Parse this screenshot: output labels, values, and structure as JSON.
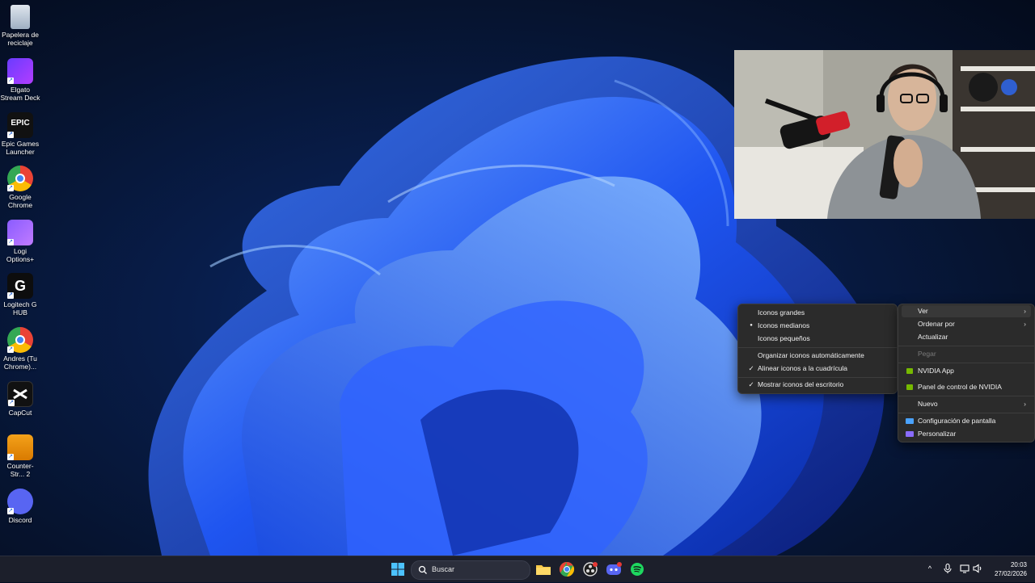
{
  "desktop_icons": [
    {
      "label": "Papelera de reciclaje",
      "icon": "recycle-bin-icon"
    },
    {
      "label": "Elgato Stream Deck",
      "icon": "stream-deck-icon"
    },
    {
      "label": "Epic Games Launcher",
      "icon": "epic-games-icon",
      "glyph": "EPIC"
    },
    {
      "label": "Google Chrome",
      "icon": "chrome-icon"
    },
    {
      "label": "Logi Options+",
      "icon": "logi-options-icon"
    },
    {
      "label": "Logitech G HUB",
      "icon": "logitech-g-hub-icon",
      "glyph": "G"
    },
    {
      "label": "Andres (Tu Chrome)...",
      "icon": "chrome-profile-icon"
    },
    {
      "label": "CapCut",
      "icon": "capcut-icon"
    },
    {
      "label": "Counter-Str... 2",
      "icon": "counter-strike-icon"
    },
    {
      "label": "Discord",
      "icon": "discord-icon"
    }
  ],
  "context_menu": {
    "items": [
      {
        "label": "Ver",
        "submenu": true
      },
      {
        "label": "Ordenar por",
        "submenu": true
      },
      {
        "label": "Actualizar"
      },
      {
        "label": "Pegar",
        "disabled": true
      },
      {
        "label": "NVIDIA App",
        "icon": "nvidia-icon"
      },
      {
        "label": "Panel de control de NVIDIA",
        "icon": "nvidia-icon"
      },
      {
        "label": "Nuevo",
        "submenu": true
      },
      {
        "label": "Configuración de pantalla",
        "icon": "display-icon"
      },
      {
        "label": "Personalizar",
        "icon": "personalize-icon"
      }
    ],
    "arrow": "›"
  },
  "view_submenu": {
    "items": [
      {
        "label": "Iconos grandes"
      },
      {
        "label": "Iconos medianos",
        "mark": "●"
      },
      {
        "label": "Iconos pequeños"
      },
      {
        "label": "Organizar iconos automáticamente"
      },
      {
        "label": "Alinear iconos a la cuadrícula",
        "mark": "✓"
      },
      {
        "label": "Mostrar iconos del escritorio",
        "mark": "✓"
      }
    ]
  },
  "taskbar": {
    "search_label": "Buscar",
    "apps": [
      "start-icon",
      "file-explorer-icon",
      "chrome-icon",
      "obs-icon",
      "discord-icon",
      "spotify-icon"
    ],
    "clock_time": "20:03",
    "clock_date": "27/02/2026",
    "tray_chevron": "^"
  },
  "colors": {
    "accent": "#2a5cff",
    "menu_bg": "#2b2b2b",
    "nvidia": "#76b900",
    "taskbar_bg": "#1c1f2b"
  }
}
